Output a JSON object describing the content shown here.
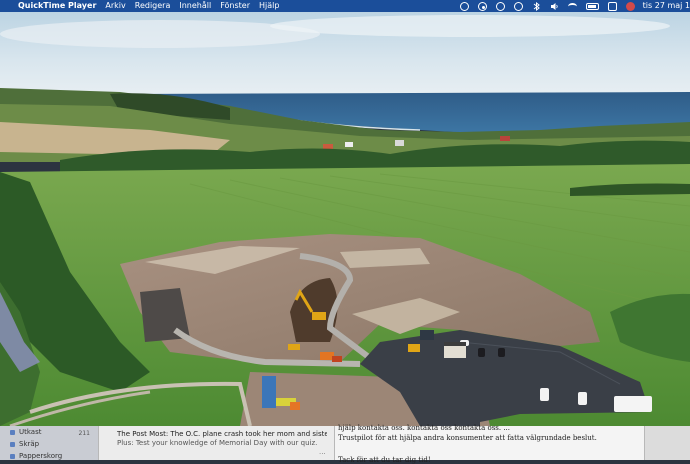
{
  "menubar": {
    "app_name": "QuickTime Player",
    "menus": [
      "Arkiv",
      "Redigera",
      "Innehåll",
      "Fönster",
      "Hjälp"
    ],
    "status_icons": [
      "creative-cloud-icon",
      "screen-record-icon",
      "time-machine-icon",
      "clock-icon",
      "bluetooth-icon",
      "volume-icon",
      "wifi-icon",
      "battery-icon",
      "control-center-icon",
      "user-icon"
    ],
    "clock": "tis 27 maj  1"
  },
  "video": {
    "description_colors": {
      "sky": "#cfe0ea",
      "sea": "#34638f",
      "field": "#5f9a3c",
      "soil": "#9a8574",
      "asphalt": "#3a3f47"
    }
  },
  "mail": {
    "sidebar": [
      {
        "label": "Utkast",
        "count": "211"
      },
      {
        "label": "Skräp",
        "count": ""
      },
      {
        "label": "Papperskorg",
        "count": ""
      }
    ],
    "list": {
      "subject": "The Post Most: The O.C. plane crash took her mom and sister. She tu...",
      "snippet": "Plus: Test your knowledge of Memorial Day with our quiz.",
      "more": "..."
    },
    "reader": {
      "line1": "hjälp kontakta oss. kontakta oss kontakta oss. ...",
      "line2": "Trustpilot för att hjälpa andra konsumenter att fatta välgrundade beslut.",
      "line3": "Tack för att du tar dig tid!"
    }
  }
}
